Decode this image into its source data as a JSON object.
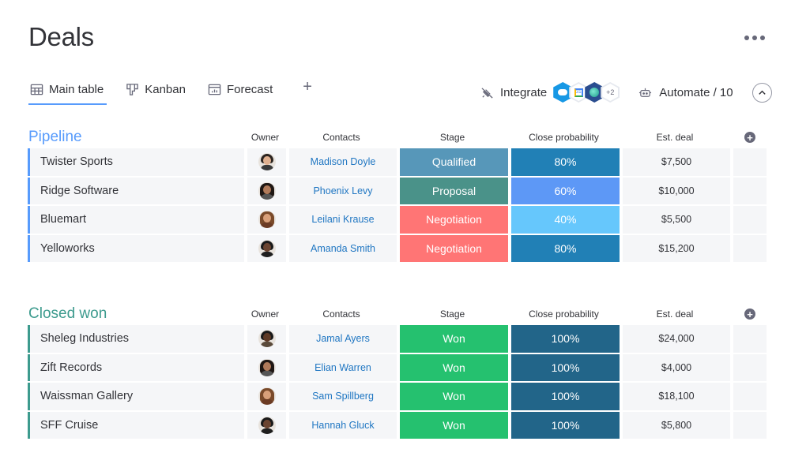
{
  "title": "Deals",
  "views": [
    {
      "label": "Main table",
      "icon": "table-icon",
      "active": true
    },
    {
      "label": "Kanban",
      "icon": "kanban-icon",
      "active": false
    },
    {
      "label": "Forecast",
      "icon": "forecast-icon",
      "active": false
    }
  ],
  "add_view_label": "+",
  "integrate": {
    "label": "Integrate",
    "apps": [
      "salesforce",
      "google-calendar",
      "crm-app"
    ],
    "more_count": "+2"
  },
  "automate": {
    "label": "Automate / 10"
  },
  "colors": {
    "pipeline": "#579bfc",
    "closed_won": "#3d9b8e",
    "qualified": "#5797b9",
    "proposal": "#4a9289",
    "negotiation": "#ff7575",
    "won": "#25c16f",
    "prob_80": "#2180b6",
    "prob_60": "#5d98f6",
    "prob_40": "#66c7fc",
    "prob_100": "#226589"
  },
  "columns": {
    "owner": "Owner",
    "contacts": "Contacts",
    "stage": "Stage",
    "close_probability": "Close probability",
    "est_deal": "Est. deal"
  },
  "groups": [
    {
      "title": "Pipeline",
      "rows": [
        {
          "name": "Twister Sports",
          "owner": "owner-1",
          "contact": "Madison Doyle",
          "stage": "Qualified",
          "stage_color": "#5797b9",
          "probability": "80%",
          "prob_color": "#2180b6",
          "deal": "$7,500"
        },
        {
          "name": "Ridge Software",
          "owner": "owner-2",
          "contact": "Phoenix Levy",
          "stage": "Proposal",
          "stage_color": "#4a9289",
          "probability": "60%",
          "prob_color": "#5d98f6",
          "deal": "$10,000"
        },
        {
          "name": "Bluemart",
          "owner": "owner-3",
          "contact": "Leilani Krause",
          "stage": "Negotiation",
          "stage_color": "#ff7575",
          "probability": "40%",
          "prob_color": "#66c7fc",
          "deal": "$5,500"
        },
        {
          "name": "Yelloworks",
          "owner": "owner-4",
          "contact": "Amanda Smith",
          "stage": "Negotiation",
          "stage_color": "#ff7575",
          "probability": "80%",
          "prob_color": "#2180b6",
          "deal": "$15,200"
        }
      ]
    },
    {
      "title": "Closed won",
      "rows": [
        {
          "name": "Sheleg Industries",
          "owner": "owner-5",
          "contact": "Jamal Ayers",
          "stage": "Won",
          "stage_color": "#25c16f",
          "probability": "100%",
          "prob_color": "#226589",
          "deal": "$24,000"
        },
        {
          "name": "Zift Records",
          "owner": "owner-2",
          "contact": "Elian Warren",
          "stage": "Won",
          "stage_color": "#25c16f",
          "probability": "100%",
          "prob_color": "#226589",
          "deal": "$4,000"
        },
        {
          "name": "Waissman Gallery",
          "owner": "owner-3",
          "contact": "Sam Spillberg",
          "stage": "Won",
          "stage_color": "#25c16f",
          "probability": "100%",
          "prob_color": "#226589",
          "deal": "$18,100"
        },
        {
          "name": "SFF Cruise",
          "owner": "owner-4",
          "contact": "Hannah Gluck",
          "stage": "Won",
          "stage_color": "#25c16f",
          "probability": "100%",
          "prob_color": "#226589",
          "deal": "$5,800"
        }
      ]
    }
  ]
}
